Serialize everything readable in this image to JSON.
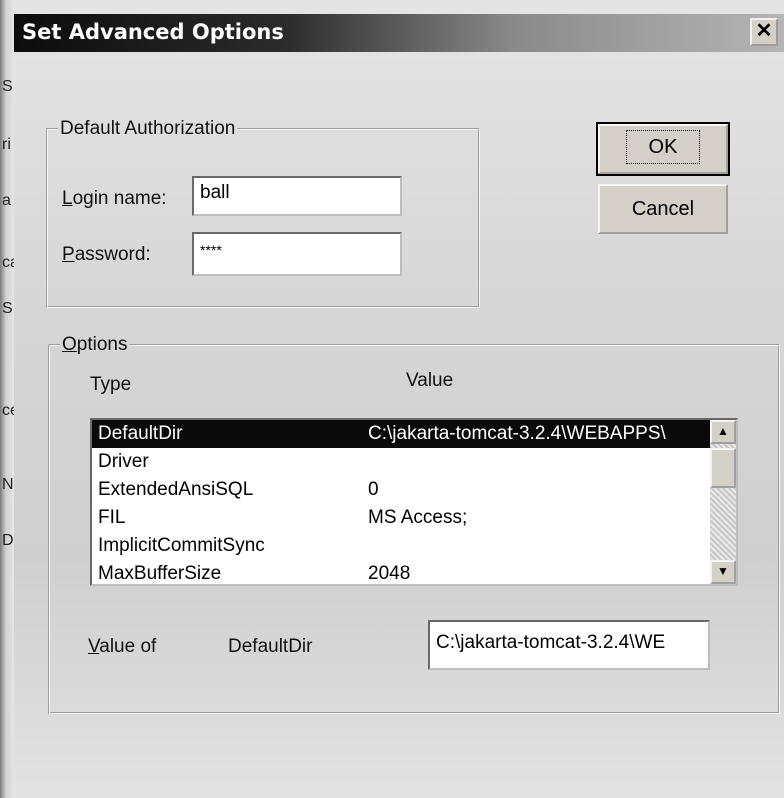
{
  "dialog": {
    "title": "Set Advanced Options",
    "close_glyph": "✕"
  },
  "auth": {
    "legend": "Default Authorization",
    "login_label_mnemonic": "L",
    "login_label_rest": "ogin name:",
    "login_value": "ball",
    "password_label_mnemonic": "P",
    "password_label_rest": "assword:",
    "password_value": "****"
  },
  "buttons": {
    "ok": "OK",
    "cancel": "Cancel"
  },
  "options": {
    "legend_mnemonic": "O",
    "legend_rest": "ptions",
    "col_type": "Type",
    "col_value": "Value",
    "rows": [
      {
        "type": "DefaultDir",
        "value": "C:\\jakarta-tomcat-3.2.4\\WEBAPPS\\"
      },
      {
        "type": "Driver",
        "value": ""
      },
      {
        "type": "ExtendedAnsiSQL",
        "value": "0"
      },
      {
        "type": "FIL",
        "value": "MS Access;"
      },
      {
        "type": "ImplicitCommitSync",
        "value": ""
      },
      {
        "type": "MaxBufferSize",
        "value": "2048"
      }
    ],
    "value_of_mnemonic": "V",
    "value_of_rest": "alue of",
    "selected_key": "DefaultDir",
    "selected_value": "C:\\jakarta-tomcat-3.2.4\\WE"
  },
  "left_strip_letters": [
    "S",
    "ri",
    "a",
    "ca",
    "S",
    "ce",
    "N",
    "D"
  ],
  "icons": [
    "close-icon",
    "scroll-up-arrow-icon",
    "scroll-down-arrow-icon"
  ]
}
